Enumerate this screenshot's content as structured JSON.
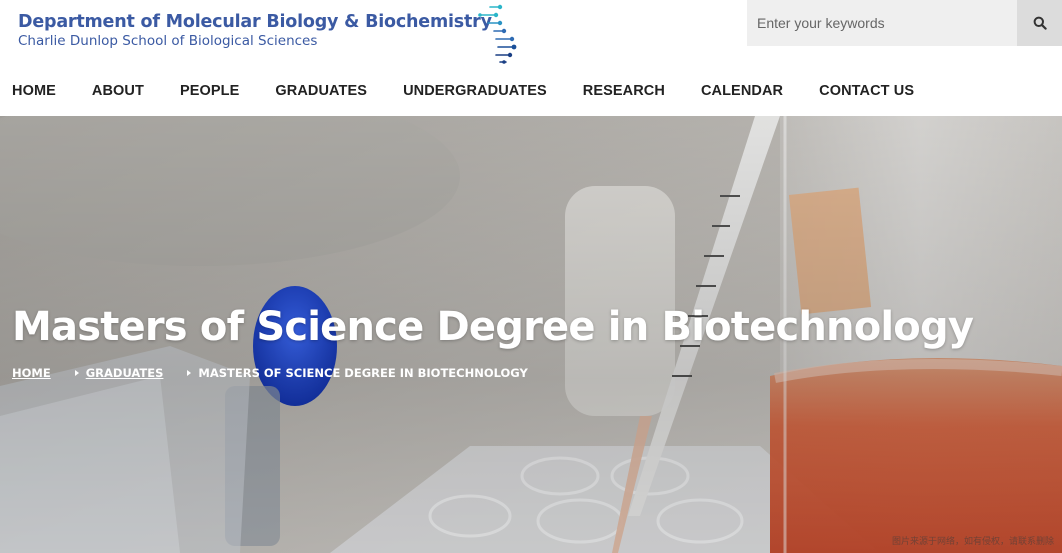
{
  "brand": {
    "title": "Department of Molecular Biology & Biochemistry",
    "subtitle": "Charlie Dunlop School of Biological Sciences",
    "logo_icon": "dna-strand-icon",
    "logo_colors": [
      "#2bb5c9",
      "#2e6bb3",
      "#1a3f84"
    ]
  },
  "search": {
    "placeholder": "Enter your keywords",
    "value": "",
    "button_icon": "search-icon"
  },
  "nav": {
    "items": [
      {
        "label": "HOME"
      },
      {
        "label": "ABOUT"
      },
      {
        "label": "PEOPLE"
      },
      {
        "label": "GRADUATES"
      },
      {
        "label": "UNDERGRADUATES"
      },
      {
        "label": "RESEARCH"
      },
      {
        "label": "CALENDAR"
      },
      {
        "label": "CONTACT US"
      }
    ]
  },
  "hero": {
    "title": "Masters of Science Degree in Biotechnology",
    "breadcrumb": {
      "home": "HOME",
      "parent": "GRADUATES",
      "current": "MASTERS OF SCIENCE DEGREE IN BIOTECHNOLOGY"
    },
    "watermark": "图片来源于网络，如有侵权，请联系删除"
  },
  "colors": {
    "brand_blue": "#3b5aa3",
    "nav_text": "#222222",
    "search_bg": "#efefef",
    "search_button_bg": "#dcdcdc"
  }
}
